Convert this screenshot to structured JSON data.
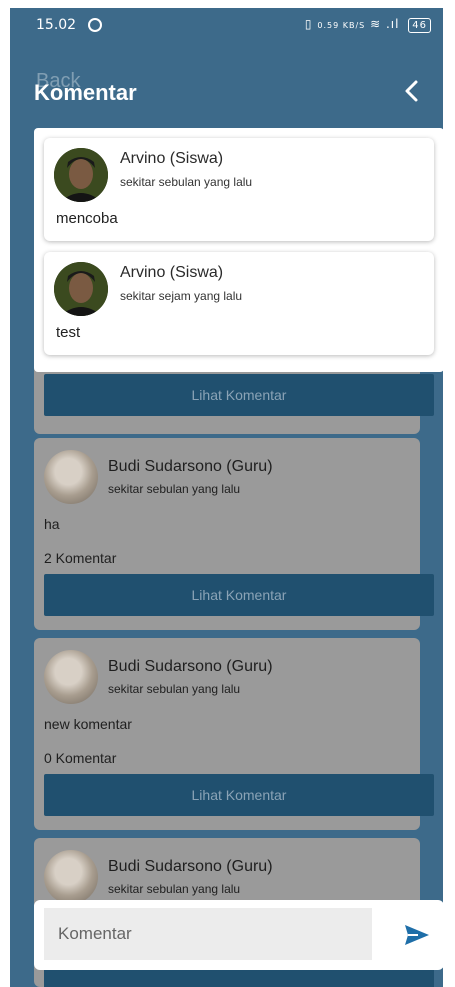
{
  "status_bar": {
    "time": "15.02",
    "net_speed": "0.59 KB/S",
    "battery": "46"
  },
  "header": {
    "ghost_text": "Back",
    "title": "Komentar",
    "close_icon": "chevron-left-icon"
  },
  "modal": {
    "comments": [
      {
        "author": "Arvino (Siswa)",
        "time": "sekitar sebulan yang lalu",
        "text": "mencoba"
      },
      {
        "author": "Arvino (Siswa)",
        "time": "sekitar sejam yang lalu",
        "text": "test"
      }
    ]
  },
  "feed": {
    "lihat_label": "Lihat Komentar",
    "posts": [
      {
        "author": "Budi Sudarsono (Guru)",
        "time": "sekitar sebulan yang lalu",
        "text": "ha",
        "count": "2 Komentar"
      },
      {
        "author": "Budi Sudarsono (Guru)",
        "time": "sekitar sebulan yang lalu",
        "text": "new komentar",
        "count": "0 Komentar"
      },
      {
        "author": "Budi Sudarsono (Guru)",
        "time": "sekitar sebulan yang lalu"
      }
    ]
  },
  "composer": {
    "placeholder": "Komentar",
    "send_icon": "send-icon"
  },
  "colors": {
    "header_bg": "#3d6a8a",
    "button_bg": "#20506f",
    "send_accent": "#1e6ea8"
  }
}
